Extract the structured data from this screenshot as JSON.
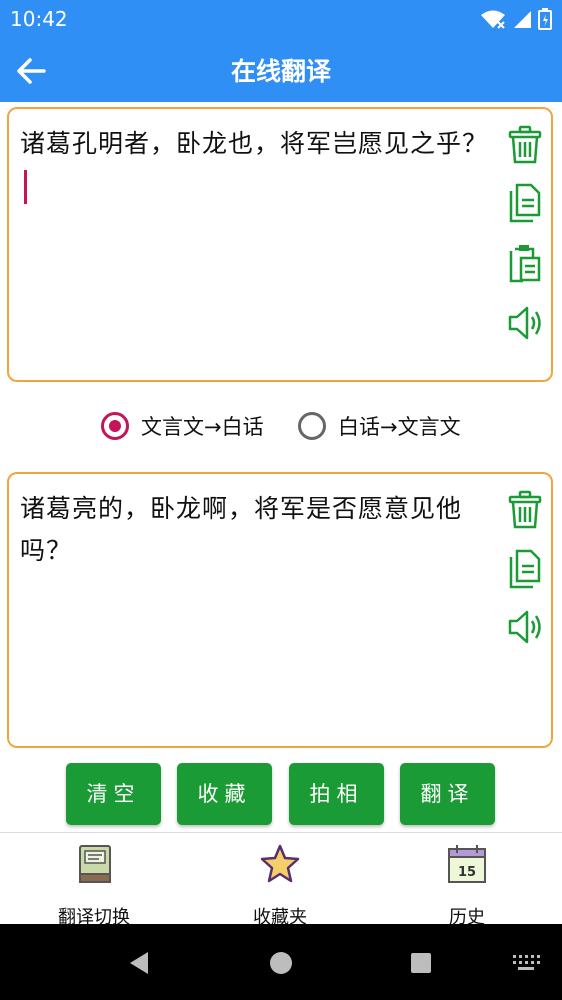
{
  "status_bar": {
    "time": "10:42"
  },
  "app_bar": {
    "title": "在线翻译"
  },
  "input": {
    "text": "诸葛孔明者，卧龙也，将军岂愿见之乎？"
  },
  "direction": {
    "options": [
      "文言文→白话",
      "白话→文言文"
    ],
    "selected": "文言文→白话"
  },
  "output": {
    "text": "诸葛亮的，卧龙啊，将军是否愿意见他吗？"
  },
  "buttons": {
    "clear": "清空",
    "favorite": "收藏",
    "photo": "拍相",
    "translate": "翻译"
  },
  "bottom_nav": {
    "items": [
      {
        "label": "翻译切换",
        "icon": "book-icon"
      },
      {
        "label": "收藏夹",
        "icon": "star-icon"
      },
      {
        "label": "历史",
        "icon": "calendar-icon"
      }
    ],
    "calendar_day": "15"
  },
  "colors": {
    "primary": "#2f8ff5",
    "button": "#1b9b35",
    "border": "#f0a640",
    "accent": "#c4145a",
    "icon_green": "#1b9b35"
  }
}
